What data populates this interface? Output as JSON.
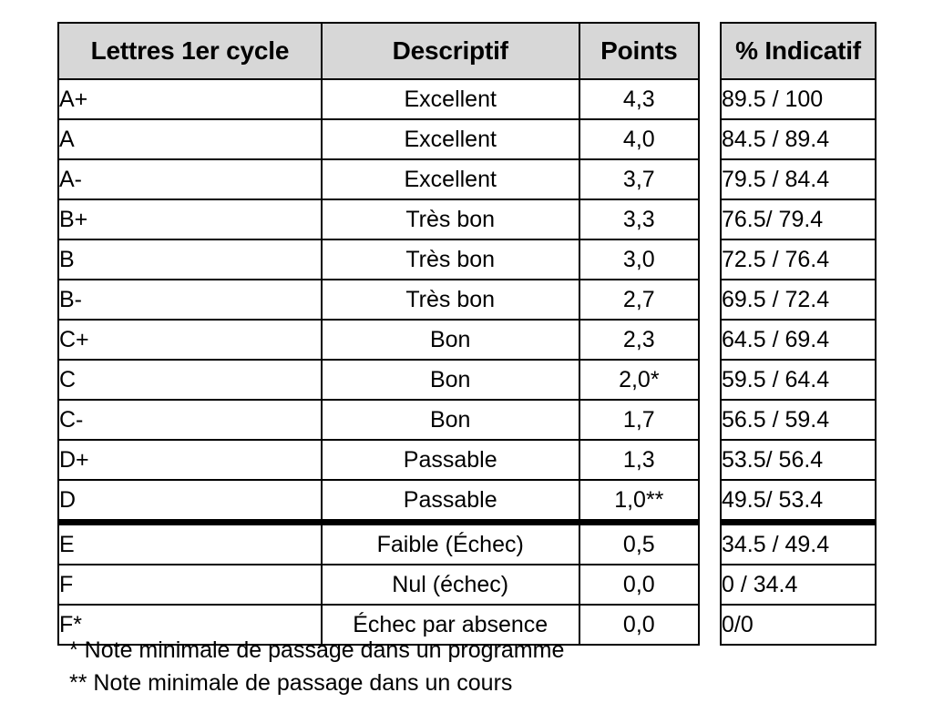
{
  "table": {
    "headers": {
      "letter": "Lettres 1er cycle",
      "descriptif": "Descriptif",
      "points": "Points",
      "percent": "% Indicatif"
    },
    "rows": [
      {
        "letter": "A+",
        "descriptif": "Excellent",
        "points": "4,3",
        "percent": "89.5 / 100"
      },
      {
        "letter": "A",
        "descriptif": "Excellent",
        "points": "4,0",
        "percent": "84.5 / 89.4"
      },
      {
        "letter": "A-",
        "descriptif": "Excellent",
        "points": "3,7",
        "percent": "79.5 / 84.4"
      },
      {
        "letter": "B+",
        "descriptif": "Très bon",
        "points": "3,3",
        "percent": "76.5/ 79.4"
      },
      {
        "letter": "B",
        "descriptif": "Très bon",
        "points": "3,0",
        "percent": "72.5 / 76.4"
      },
      {
        "letter": "B-",
        "descriptif": "Très bon",
        "points": "2,7",
        "percent": "69.5 / 72.4"
      },
      {
        "letter": "C+",
        "descriptif": "Bon",
        "points": "2,3",
        "percent": "64.5 / 69.4"
      },
      {
        "letter": "C",
        "descriptif": "Bon",
        "points": "2,0*",
        "percent": "59.5 / 64.4"
      },
      {
        "letter": "C-",
        "descriptif": "Bon",
        "points": "1,7",
        "percent": "56.5 / 59.4"
      },
      {
        "letter": "D+",
        "descriptif": "Passable",
        "points": "1,3",
        "percent": "53.5/ 56.4"
      },
      {
        "letter": "D",
        "descriptif": "Passable",
        "points": "1,0**",
        "percent": "49.5/ 53.4"
      },
      {
        "letter": "E",
        "descriptif": "Faible (Échec)",
        "points": "0,5",
        "percent": "34.5 / 49.4"
      },
      {
        "letter": "F",
        "descriptif": "Nul (échec)",
        "points": "0,0",
        "percent": "0 / 34.4"
      },
      {
        "letter": "F*",
        "descriptif": "Échec par absence",
        "points": "0,0",
        "percent": "0/0"
      }
    ],
    "separator_after_row_index": 10
  },
  "footnotes": [
    "* Note minimale de passage dans un programme",
    "** Note minimale de passage dans un cours"
  ],
  "colors": {
    "header_background": "#d7d7d7",
    "border": "#000000",
    "page_background": "#ffffff",
    "text": "#000000"
  }
}
